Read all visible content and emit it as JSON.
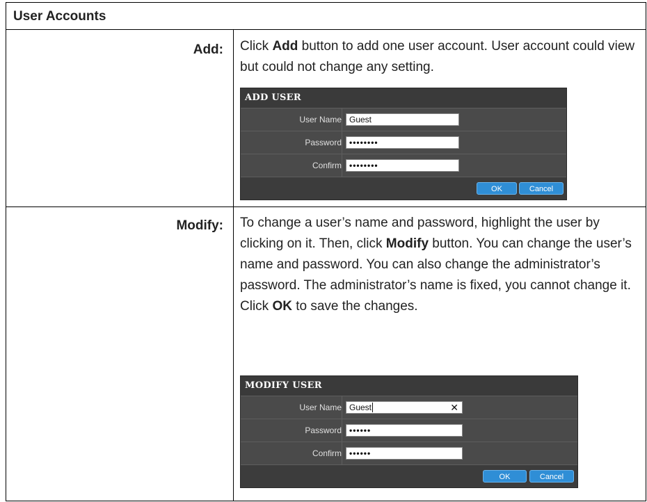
{
  "section_title": "User Accounts",
  "add": {
    "label": "Add:",
    "text_prefix": "Click ",
    "text_bold": "Add",
    "text_suffix": " button to add one user account. User account could view but could not change any setting.",
    "dialog": {
      "title": "ADD USER",
      "fields": [
        {
          "label": "User Name",
          "value": "Guest"
        },
        {
          "label": "Password",
          "value": "••••••••"
        },
        {
          "label": "Confirm",
          "value": "••••••••"
        }
      ],
      "ok_label": "OK",
      "cancel_label": "Cancel"
    }
  },
  "modify": {
    "label": "Modify:",
    "text_part1": "To change a user’s name and password, highlight the user by clicking on it. Then, click ",
    "text_bold1": "Modify",
    "text_part2": " button. You can change the user’s name and password. You can also change the administrator’s password.  The administrator’s name is fixed, you cannot change it. Click ",
    "text_bold2": "OK",
    "text_part3": " to save the changes.",
    "dialog": {
      "title": "MODIFY USER",
      "fields": [
        {
          "label": "User Name",
          "value": "Guest"
        },
        {
          "label": "Password",
          "value": "••••••"
        },
        {
          "label": "Confirm",
          "value": "••••••"
        }
      ],
      "clear_glyph": "✕",
      "ok_label": "OK",
      "cancel_label": "Cancel"
    }
  }
}
